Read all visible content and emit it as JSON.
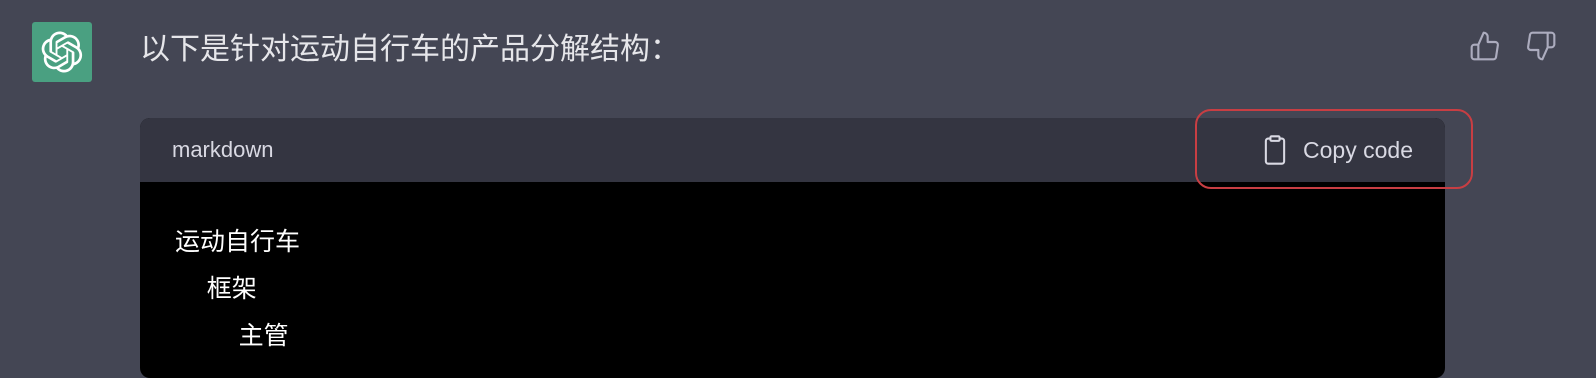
{
  "assistant": {
    "avatar_icon": "openai-logo-icon",
    "avatar_color": "#4aa081"
  },
  "message": {
    "intro_text": "以下是针对运动自行车的产品分解结构："
  },
  "feedback": {
    "thumbs_up_icon": "thumbs-up-icon",
    "thumbs_down_icon": "thumbs-down-icon"
  },
  "code_block": {
    "language": "markdown",
    "copy_label": "Copy code",
    "copy_icon": "clipboard-icon",
    "lines": [
      "运动自行车",
      "    框架",
      "        主管"
    ]
  },
  "highlight": {
    "color": "#c83e43"
  }
}
